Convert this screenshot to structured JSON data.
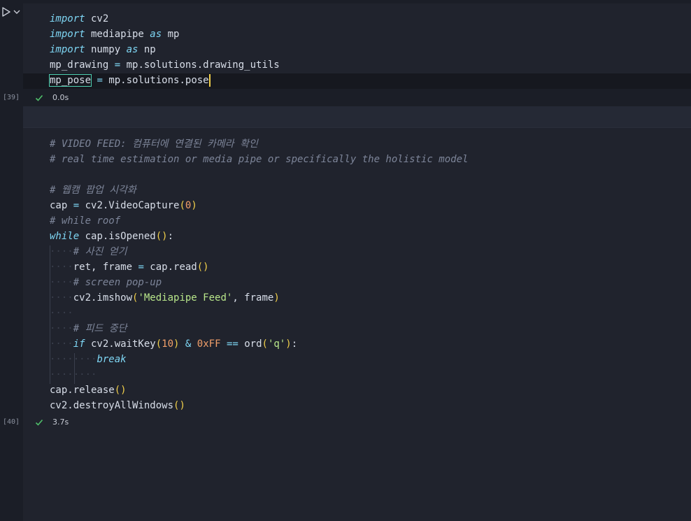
{
  "cells": [
    {
      "exec_count": "[39]",
      "duration": "0.0s",
      "lines": [
        "import cv2",
        "import mediapipe as mp",
        "import numpy as np",
        "mp_drawing = mp.solutions.drawing_utils",
        "mp_pose = mp.solutions.pose"
      ]
    },
    {
      "exec_count": "[40]",
      "duration": "3.7s",
      "lines": [
        "# VIDEO FEED: 컴퓨터에 연결된 카메라 확인",
        "# real time estimation or media pipe or specifically the holistic model",
        "",
        "# 웹캠 팝업 시각화",
        "cap = cv2.VideoCapture(0)",
        "# while roof",
        "while cap.isOpened():",
        "    # 사진 얻기",
        "    ret, frame = cap.read()",
        "    # screen pop-up",
        "    cv2.imshow('Mediapipe Feed', frame)",
        "    ",
        "    # 피드 중단",
        "    if cv2.waitKey(10) & 0xFF == ord('q'):",
        "        break",
        "        ",
        "cap.release()",
        "cv2.destroyAllWindows()"
      ]
    }
  ],
  "icons": {
    "run": "play-triangle-icon",
    "run_menu": "chevron-down-icon",
    "success": "check-icon"
  },
  "colors": {
    "background": "#1b1e27",
    "editor": "#20232d",
    "keyword": "#7fd7f5",
    "paren": "#f2d04a",
    "number": "#f3a06a",
    "string": "#b8e68a",
    "comment": "#7d8599",
    "check": "#4fbf6a",
    "bracket_match": "#4fd1b2"
  }
}
